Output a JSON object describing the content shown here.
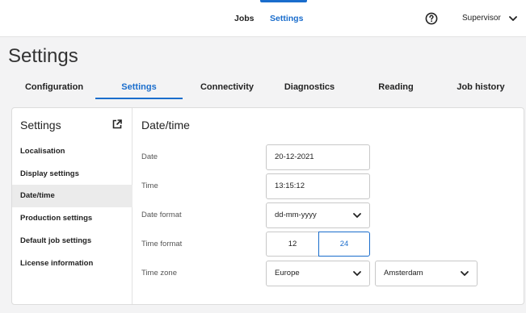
{
  "topnav": {
    "items": [
      {
        "label": "Jobs",
        "active": false
      },
      {
        "label": "Settings",
        "active": true
      }
    ],
    "user": "Supervisor"
  },
  "page": {
    "title": "Settings"
  },
  "tabs": [
    {
      "label": "Configuration",
      "active": false
    },
    {
      "label": "Settings",
      "active": true
    },
    {
      "label": "Connectivity",
      "active": false
    },
    {
      "label": "Diagnostics",
      "active": false
    },
    {
      "label": "Reading",
      "active": false
    },
    {
      "label": "Job history",
      "active": false
    }
  ],
  "sidebar": {
    "title": "Settings",
    "items": [
      {
        "label": "Localisation",
        "active": false
      },
      {
        "label": "Display settings",
        "active": false
      },
      {
        "label": "Date/time",
        "active": true
      },
      {
        "label": "Production settings",
        "active": false
      },
      {
        "label": "Default job settings",
        "active": false
      },
      {
        "label": "License information",
        "active": false
      }
    ]
  },
  "content": {
    "title": "Date/time",
    "date": {
      "label": "Date",
      "value": "20-12-2021"
    },
    "time": {
      "label": "Time",
      "value": "13:15:12"
    },
    "date_format": {
      "label": "Date format",
      "value": "dd-mm-yyyy"
    },
    "time_format": {
      "label": "Time format",
      "options": [
        "12",
        "24"
      ],
      "selected": "24"
    },
    "time_zone": {
      "label": "Time zone",
      "region": "Europe",
      "city": "Amsterdam"
    }
  },
  "colors": {
    "accent": "#1a6dcc",
    "background": "#f3f3f4",
    "active_row": "#ebebeb"
  },
  "icons": {
    "help": "help-circle-icon",
    "external": "external-link-icon",
    "dropdown": "chevron-down-icon"
  }
}
